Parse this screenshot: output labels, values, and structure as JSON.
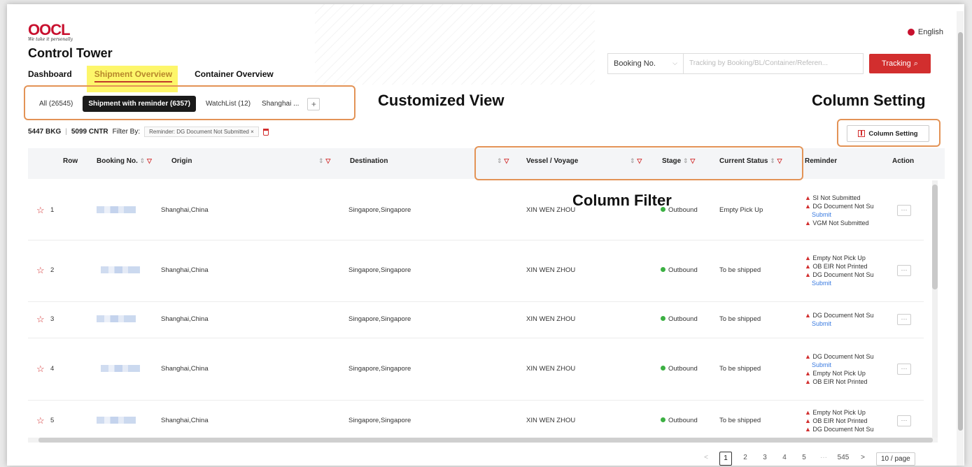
{
  "logo": {
    "mark": "OOCL",
    "tagline": "We take it personally"
  },
  "app_title": "Control Tower",
  "language": "English",
  "nav": {
    "tabs": [
      "Dashboard",
      "Shipment Overview",
      "Container Overview"
    ],
    "active": "Shipment Overview"
  },
  "search": {
    "type_select": "Booking No.",
    "placeholder": "Tracking by Booking/BL/Container/Referen...",
    "button": "Tracking"
  },
  "views": {
    "all": "All (26545)",
    "reminder": "Shipment with reminder (6357)",
    "watchlist": "WatchList (12)",
    "shanghai": "Shanghai ...",
    "add": "+"
  },
  "annotations": {
    "customized_view": "Customized View",
    "column_setting": "Column Setting",
    "column_filter": "Column Filter"
  },
  "summary": {
    "bkg": "5447 BKG",
    "cntr": "5099 CNTR",
    "filter_by": "Filter By:",
    "filter_chip": "Reminder: DG Document Not Submitted  ×"
  },
  "column_setting_button": "Column Setting",
  "columns": {
    "row": "Row",
    "booking": "Booking No.",
    "origin": "Origin",
    "destination": "Destination",
    "vessel": "Vessel / Voyage",
    "stage": "Stage",
    "status": "Current Status",
    "reminder": "Reminder",
    "action": "Action"
  },
  "rows": [
    {
      "row": "1",
      "origin": "Shanghai,China",
      "destination": "Singapore,Singapore",
      "vessel": "XIN WEN ZHOU",
      "stage": "Outbound",
      "status": "Empty Pick Up",
      "reminders": [
        "SI Not Submitted",
        "DG Document Not Su",
        "VGM Not Submitted"
      ],
      "link": "Submit"
    },
    {
      "row": "2",
      "origin": "Shanghai,China",
      "destination": "Singapore,Singapore",
      "vessel": "XIN WEN ZHOU",
      "stage": "Outbound",
      "status": "To be shipped",
      "reminders": [
        "Empty Not Pick Up",
        "OB EIR Not Printed",
        "DG Document Not Su"
      ],
      "link": "Submit"
    },
    {
      "row": "3",
      "origin": "Shanghai,China",
      "destination": "Singapore,Singapore",
      "vessel": "XIN WEN ZHOU",
      "stage": "Outbound",
      "status": "To be shipped",
      "reminders": [
        "DG Document Not Su"
      ],
      "link": "Submit"
    },
    {
      "row": "4",
      "origin": "Shanghai,China",
      "destination": "Singapore,Singapore",
      "vessel": "XIN WEN ZHOU",
      "stage": "Outbound",
      "status": "To be shipped",
      "reminders": [
        "DG Document Not Su",
        "Empty Not Pick Up",
        "OB EIR Not Printed"
      ],
      "link": "Submit"
    },
    {
      "row": "5",
      "origin": "Shanghai,China",
      "destination": "Singapore,Singapore",
      "vessel": "XIN WEN ZHOU",
      "stage": "Outbound",
      "status": "To be shipped",
      "reminders": [
        "Empty Not Pick Up",
        "OB EIR Not Printed",
        "DG Document Not Su"
      ],
      "link": ""
    }
  ],
  "pagination": {
    "prev": "<",
    "pages": [
      "1",
      "2",
      "3",
      "4",
      "5"
    ],
    "ellipsis": "···",
    "last": "545",
    "next": ">",
    "current": "1",
    "page_size": "10 / page"
  },
  "colors": {
    "brand_red": "#c8102e",
    "highlight": "#fdf66a",
    "annotation_border": "#e39356",
    "stage_green": "#3cb043"
  }
}
